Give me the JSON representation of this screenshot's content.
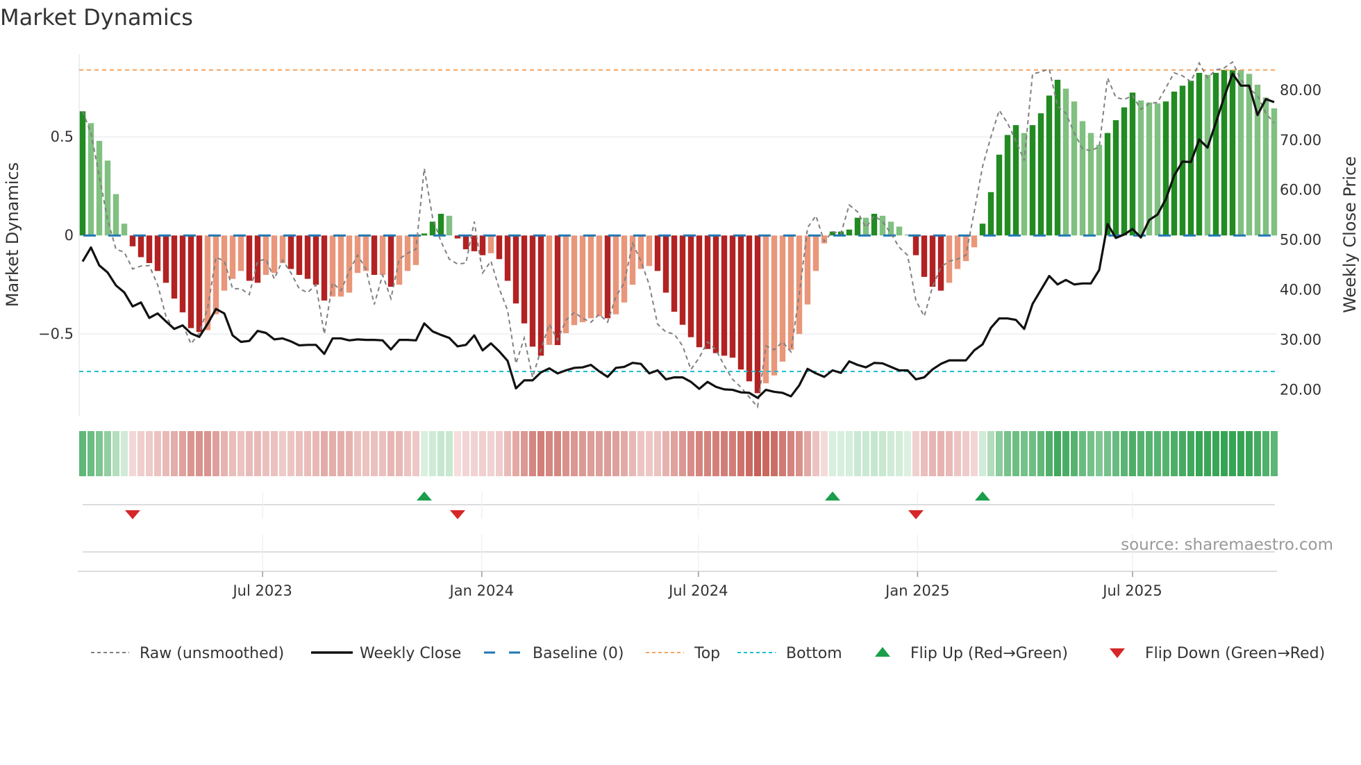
{
  "chart_data": {
    "type": "bar",
    "title": "Market Dynamics",
    "ylabel_left": "Market Dynamics",
    "ylabel_right": "Weekly Close Price",
    "ylim_left": [
      -0.915,
      0.92
    ],
    "ylim_right": [
      14.8,
      87.2
    ],
    "left_yticks": [
      {
        "value": 0.5,
        "label": "0.5"
      },
      {
        "value": 0,
        "label": "0"
      },
      {
        "value": -0.5,
        "label": "−0.5"
      }
    ],
    "right_yticks": [
      {
        "value": 80,
        "label": "80.00"
      },
      {
        "value": 70,
        "label": "70.00"
      },
      {
        "value": 60,
        "label": "60.00"
      },
      {
        "value": 50,
        "label": "50.00"
      },
      {
        "value": 40,
        "label": "40.00"
      },
      {
        "value": 30,
        "label": "30.00"
      },
      {
        "value": 20,
        "label": "20.00"
      }
    ],
    "x_ticks": [
      {
        "label": "Jul 2023",
        "week": 21.6
      },
      {
        "label": "Jan 2024",
        "week": 47.9
      },
      {
        "label": "Jul 2024",
        "week": 73.9
      },
      {
        "label": "Jan 2025",
        "week": 100.2
      },
      {
        "label": "Jul 2025",
        "week": 126.0
      }
    ],
    "grid": true,
    "top_level": 0.84,
    "bottom_level": -0.69,
    "baseline": 0,
    "momentum": [
      0.63,
      0.57,
      0.48,
      0.38,
      0.21,
      0.06,
      -0.055,
      -0.11,
      -0.14,
      -0.18,
      -0.24,
      -0.32,
      -0.39,
      -0.47,
      -0.49,
      -0.48,
      -0.4,
      -0.28,
      -0.22,
      -0.18,
      -0.23,
      -0.24,
      -0.2,
      -0.19,
      -0.14,
      -0.17,
      -0.2,
      -0.22,
      -0.25,
      -0.33,
      -0.31,
      -0.31,
      -0.29,
      -0.19,
      -0.18,
      -0.2,
      -0.2,
      -0.26,
      -0.25,
      -0.18,
      -0.15,
      0.01,
      0.07,
      0.11,
      0.1,
      -0.015,
      -0.07,
      -0.08,
      -0.1,
      -0.09,
      -0.12,
      -0.23,
      -0.345,
      -0.446,
      -0.564,
      -0.61,
      -0.555,
      -0.556,
      -0.496,
      -0.455,
      -0.44,
      -0.42,
      -0.41,
      -0.42,
      -0.4,
      -0.34,
      -0.25,
      -0.17,
      -0.155,
      -0.18,
      -0.29,
      -0.387,
      -0.453,
      -0.516,
      -0.567,
      -0.576,
      -0.597,
      -0.61,
      -0.62,
      -0.68,
      -0.74,
      -0.8,
      -0.75,
      -0.71,
      -0.64,
      -0.58,
      -0.5,
      -0.35,
      -0.18,
      -0.04,
      0.02,
      0.02,
      0.03,
      0.09,
      0.09,
      0.11,
      0.1,
      0.07,
      0.045,
      0.005,
      -0.1,
      -0.21,
      -0.26,
      -0.28,
      -0.24,
      -0.17,
      -0.13,
      -0.06,
      0.06,
      0.22,
      0.41,
      0.51,
      0.56,
      0.52,
      0.56,
      0.62,
      0.71,
      0.79,
      0.745,
      0.68,
      0.58,
      0.52,
      0.46,
      0.52,
      0.585,
      0.65,
      0.725,
      0.685,
      0.675,
      0.67,
      0.68,
      0.73,
      0.76,
      0.785,
      0.825,
      0.815,
      0.825,
      0.84,
      0.84,
      0.84,
      0.82,
      0.765,
      0.7,
      0.645
    ],
    "strengthening": [
      1,
      0,
      0,
      0,
      0,
      0,
      1,
      1,
      1,
      1,
      1,
      1,
      1,
      1,
      1,
      0,
      0,
      0,
      0,
      0,
      1,
      1,
      0,
      0,
      0,
      1,
      1,
      1,
      1,
      1,
      0,
      0,
      0,
      0,
      0,
      1,
      0,
      1,
      0,
      0,
      0,
      1,
      1,
      1,
      0,
      1,
      1,
      1,
      1,
      0,
      1,
      1,
      1,
      1,
      1,
      1,
      0,
      1,
      0,
      0,
      0,
      0,
      0,
      1,
      0,
      0,
      0,
      0,
      0,
      1,
      1,
      1,
      1,
      1,
      1,
      1,
      1,
      1,
      1,
      1,
      1,
      1,
      0,
      0,
      0,
      0,
      0,
      0,
      0,
      0,
      1,
      1,
      1,
      1,
      0,
      1,
      0,
      0,
      0,
      0,
      1,
      1,
      1,
      1,
      0,
      0,
      0,
      0,
      1,
      1,
      1,
      1,
      1,
      0,
      1,
      1,
      1,
      1,
      0,
      0,
      0,
      0,
      0,
      1,
      1,
      1,
      1,
      0,
      0,
      0,
      1,
      1,
      1,
      1,
      1,
      0,
      1,
      1,
      1,
      0,
      0,
      0,
      0,
      0
    ],
    "raw": [
      0.63,
      0.52,
      0.3,
      0.08,
      -0.07,
      -0.085,
      -0.17,
      -0.155,
      -0.153,
      -0.25,
      -0.41,
      -0.48,
      -0.45,
      -0.55,
      -0.495,
      -0.37,
      -0.11,
      -0.13,
      -0.27,
      -0.27,
      -0.3,
      -0.13,
      -0.12,
      -0.22,
      -0.125,
      -0.19,
      -0.27,
      -0.29,
      -0.25,
      -0.5,
      -0.24,
      -0.28,
      -0.18,
      -0.1,
      -0.17,
      -0.35,
      -0.2,
      -0.32,
      -0.12,
      -0.09,
      -0.07,
      0.34,
      0.09,
      -0.03,
      -0.12,
      -0.145,
      -0.14,
      0.07,
      -0.19,
      -0.13,
      -0.27,
      -0.38,
      -0.65,
      -0.52,
      -0.72,
      -0.58,
      -0.45,
      -0.53,
      -0.43,
      -0.39,
      -0.42,
      -0.44,
      -0.4,
      -0.44,
      -0.31,
      -0.24,
      -0.04,
      -0.13,
      -0.25,
      -0.45,
      -0.49,
      -0.5,
      -0.56,
      -0.68,
      -0.62,
      -0.54,
      -0.58,
      -0.66,
      -0.73,
      -0.77,
      -0.82,
      -0.87,
      -0.56,
      -0.58,
      -0.54,
      -0.59,
      -0.3,
      0.04,
      0.1,
      -0.03,
      0.02,
      0.01,
      0.155,
      0.12,
      0.04,
      0.1,
      0.07,
      0.01,
      -0.06,
      -0.1,
      -0.33,
      -0.41,
      -0.26,
      -0.16,
      -0.13,
      -0.12,
      -0.1,
      0.12,
      0.35,
      0.5,
      0.635,
      0.57,
      0.48,
      0.38,
      0.82,
      0.83,
      0.845,
      0.655,
      0.62,
      0.52,
      0.44,
      0.43,
      0.45,
      0.8,
      0.7,
      0.69,
      0.71,
      0.64,
      0.67,
      0.675,
      0.75,
      0.825,
      0.81,
      0.78,
      0.875,
      0.8,
      0.84,
      0.85,
      0.88,
      0.79,
      0.745,
      0.71,
      0.62,
      0.57
    ],
    "close": [
      45.7,
      48.5,
      44.9,
      43.5,
      40.9,
      39.5,
      36.7,
      37.5,
      34.4,
      35.3,
      33.7,
      32.2,
      32.9,
      31.3,
      30.6,
      33.2,
      36.2,
      35.3,
      30.9,
      29.6,
      29.8,
      31.8,
      31.4,
      30.1,
      30.3,
      29.7,
      28.9,
      29.0,
      29.0,
      27.2,
      30.3,
      30.3,
      29.9,
      30.1,
      30.0,
      30.0,
      29.9,
      28.1,
      30.0,
      30.0,
      29.9,
      33.3,
      31.7,
      31.0,
      30.4,
      28.7,
      29.0,
      30.9,
      27.9,
      29.3,
      27.7,
      25.8,
      20.3,
      21.9,
      21.9,
      23.5,
      24.3,
      23.3,
      23.9,
      24.4,
      24.5,
      25.0,
      23.7,
      22.6,
      24.4,
      24.6,
      25.4,
      25.2,
      23.3,
      23.9,
      22.1,
      22.5,
      22.5,
      21.6,
      20.2,
      21.6,
      20.6,
      20.1,
      20.0,
      19.5,
      19.4,
      18.4,
      20.0,
      19.6,
      19.4,
      18.7,
      20.9,
      24.2,
      23.3,
      22.6,
      23.9,
      23.4,
      25.7,
      25.0,
      24.5,
      25.4,
      25.3,
      24.6,
      23.9,
      23.9,
      22.1,
      22.5,
      24.1,
      25.2,
      25.9,
      25.9,
      25.9,
      27.9,
      29.1,
      32.4,
      34.3,
      34.3,
      34.0,
      32.2,
      37.2,
      40.0,
      42.8,
      41.1,
      42.0,
      41.1,
      41.3,
      41.3,
      44.0,
      53.2,
      50.4,
      51.1,
      52.2,
      50.5,
      54.0,
      55.1,
      58.2,
      62.9,
      65.7,
      65.6,
      70.1,
      68.5,
      73.5,
      78.6,
      83.3,
      80.9,
      80.9,
      75.0,
      78.2,
      77.6
    ],
    "flips": [
      {
        "week": 6,
        "dir": "down"
      },
      {
        "week": 41,
        "dir": "up"
      },
      {
        "week": 45,
        "dir": "down"
      },
      {
        "week": 90,
        "dir": "up"
      },
      {
        "week": 100,
        "dir": "down"
      },
      {
        "week": 108,
        "dir": "up"
      }
    ],
    "legend": {
      "position": "bottom",
      "items": [
        {
          "key": "raw",
          "label": "Raw (unsmoothed)"
        },
        {
          "key": "close",
          "label": "Weekly Close"
        },
        {
          "key": "baseline",
          "label": "Baseline (0)"
        },
        {
          "key": "top",
          "label": "Top"
        },
        {
          "key": "bottom",
          "label": "Bottom"
        },
        {
          "key": "flip-up",
          "label": "Flip Up (Red→Green)"
        },
        {
          "key": "flip-down",
          "label": "Flip Down (Green→Red)"
        }
      ]
    },
    "source": "source: sharemaestro.com"
  },
  "colors": {
    "pos_strong": "#228b22",
    "pos_weak": "#80c080",
    "neg_strong": "#b22222",
    "neg_weak": "#e9967a",
    "raw": "#808080",
    "close": "#111111",
    "baseline": "#1f77b4",
    "top": "#f4a460",
    "bottom": "#17becf",
    "flip_up": "#1a9e4a",
    "flip_down": "#d62728"
  }
}
